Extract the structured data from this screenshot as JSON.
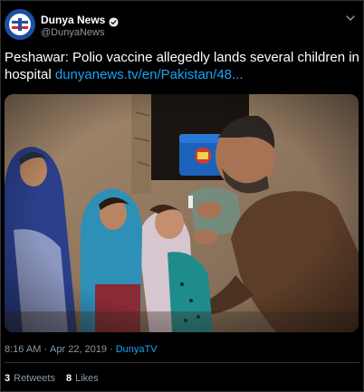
{
  "tweet": {
    "display_name": "Dunya News",
    "handle": "@DunyaNews",
    "text": "Peshawar: Polio vaccine allegedly lands several children in hospital ",
    "link": "dunyanews.tv/en/Pakistan/48...",
    "time": "8:16 AM",
    "separator": "·",
    "date": "Apr 22, 2019",
    "source": "DunyaTV",
    "retweets_count": "3",
    "retweets_label": "Retweets",
    "likes_count": "8",
    "likes_label": "Likes"
  },
  "icons": {
    "avatar": "dunya-news-logo",
    "verified": "verified-badge-icon",
    "menu": "chevron-down-icon"
  },
  "colors": {
    "background": "#000000",
    "link": "#1da1f2",
    "secondary_text": "#8899a6",
    "border": "#2f3336"
  }
}
